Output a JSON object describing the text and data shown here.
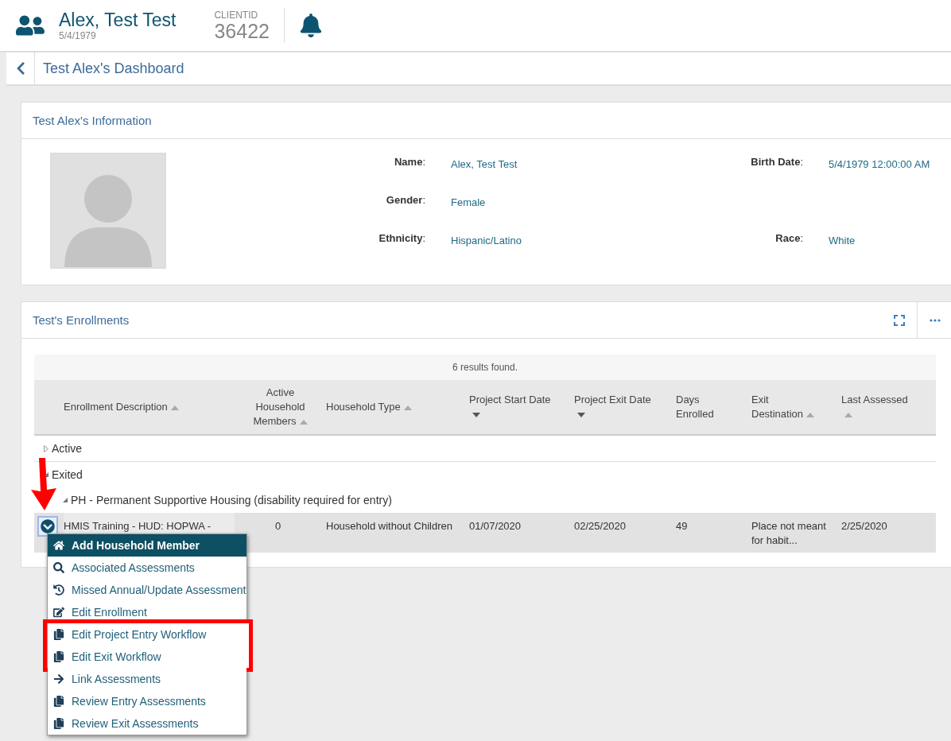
{
  "header": {
    "client_name": "Alex, Test Test",
    "birth_date": "5/4/1979",
    "client_id_label": "CLIENTID",
    "client_id": "36422"
  },
  "breadcrumb": {
    "title": "Test Alex's Dashboard"
  },
  "info_panel": {
    "title": "Test Alex's Information",
    "rows": [
      [
        {
          "label": "**Name**:",
          "value": "Alex, Test Test"
        },
        {
          "label": "**Birth Date**:",
          "value": "5/4/1979 12:00:00 AM"
        }
      ],
      [
        {
          "label": "**Gender**:",
          "value": "Female"
        }
      ],
      [
        {
          "label": "**Ethnicity**:",
          "value": "Hispanic/Latino"
        },
        {
          "label": "**Race**:",
          "value": "White"
        }
      ]
    ]
  },
  "enrollments_panel": {
    "title": "Test's Enrollments",
    "results": "6 results found.",
    "columns": [
      {
        "label": "Enrollment Description",
        "sort_descending": false
      },
      {
        "label": "Active Household Members",
        "sort_descending": false
      },
      {
        "label": "Household Type",
        "sort_descending": false
      },
      {
        "label": "Project Start Date",
        "sort_descending": true
      },
      {
        "label": "Project Exit Date",
        "sort_descending": true
      },
      {
        "label": "Days Enrolled"
      },
      {
        "label": "Exit Destination",
        "sort_descending": false
      },
      {
        "label": "Last Assessed",
        "sort_descending": false
      }
    ],
    "groups": [
      {
        "label": "Active",
        "expanded": false
      },
      {
        "label": "Exited",
        "expanded": true,
        "children": [
          {
            "label": "PH - Permanent Supportive Housing (disability required for entry)",
            "expanded": true,
            "rows": [
              {
                "cells": [
                  "HMIS Training - HUD: HOPWA -",
                  "0",
                  "Household without Children",
                  "01/07/2020",
                  "02/25/2020",
                  "49",
                  "Place not meant for habit...",
                  "2/25/2020"
                ]
              }
            ]
          }
        ]
      }
    ],
    "menu": [
      {
        "label": "Add Household Member",
        "selected": true,
        "highlighted": false
      },
      {
        "label": "Associated Assessments",
        "selected": false,
        "highlighted": false
      },
      {
        "label": "Missed Annual/Update Assessment",
        "selected": false,
        "highlighted": false
      },
      {
        "label": "Edit Enrollment",
        "selected": false,
        "highlighted": false
      },
      {
        "label": "Edit Project Entry Workflow",
        "selected": false,
        "highlighted": true
      },
      {
        "label": "Edit Exit Workflow",
        "selected": false,
        "highlighted": true
      },
      {
        "label": "Link Assessments",
        "selected": false,
        "highlighted": false
      },
      {
        "label": "Review Entry Assessments",
        "selected": false,
        "highlighted": false
      },
      {
        "label": "Review Exit Assessments",
        "selected": false,
        "highlighted": false
      }
    ]
  },
  "annotation_arrow": true
}
